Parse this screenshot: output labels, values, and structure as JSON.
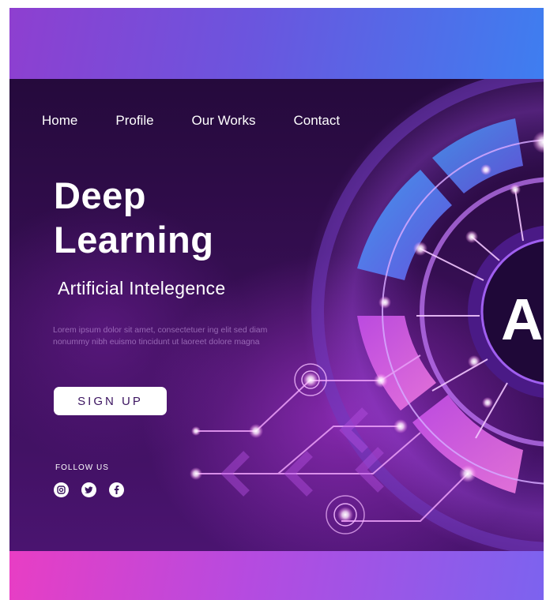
{
  "nav": {
    "items": [
      {
        "label": "Home"
      },
      {
        "label": "Profile"
      },
      {
        "label": "Our Works"
      },
      {
        "label": "Contact"
      }
    ]
  },
  "hero": {
    "title_line1": "Deep",
    "title_line2": "Learning",
    "subtitle": "Artificial Intelegence",
    "body_text": "Lorem ipsum dolor sit amet, consectetuer ing elit sed diam nonummy nibh euismo tincidunt ut laoreet dolore magna",
    "cta_label": "SIGN UP",
    "badge_text": "A"
  },
  "social": {
    "heading": "FOLLOW US",
    "icons": [
      "instagram-icon",
      "twitter-icon",
      "facebook-icon"
    ]
  },
  "colors": {
    "top_band": "#6b55de",
    "hero_bg": "#2e0c48",
    "accent_pink": "#e43fd0",
    "accent_blue": "#4f8ff5",
    "bottom_band": "#c04be0"
  }
}
